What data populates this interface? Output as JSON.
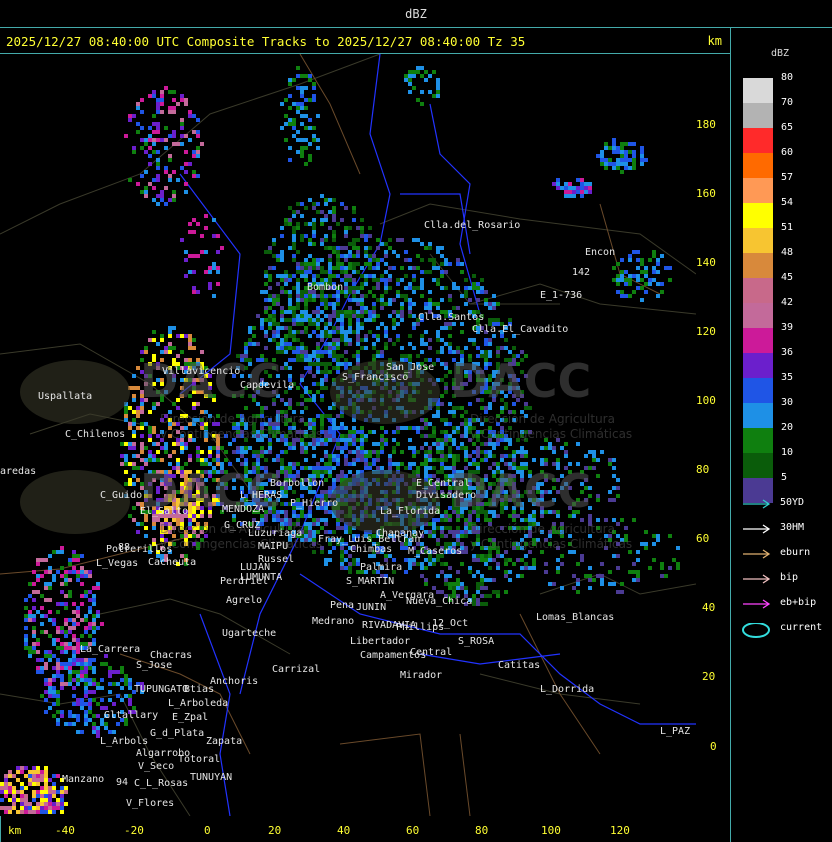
{
  "header": {
    "unit": "dBZ"
  },
  "title": {
    "text": "2025/12/27 08:40:00 UTC Composite Tracks to 2025/12/27 08:40:00 Tz 35",
    "km_label": "km"
  },
  "axes": {
    "y_ticks": [
      "180",
      "160",
      "140",
      "120",
      "100",
      "80",
      "60",
      "40",
      "20",
      "0"
    ],
    "x_ticks": [
      "-40",
      "-20",
      "0",
      "20",
      "40",
      "60",
      "80",
      "100",
      "120"
    ],
    "x_unit": "km"
  },
  "legend": {
    "title": "dBZ",
    "scale": [
      {
        "value": "80",
        "color": "#d9d9d9"
      },
      {
        "value": "70",
        "color": "#b3b3b3"
      },
      {
        "value": "65",
        "color": "#ff2a2a"
      },
      {
        "value": "60",
        "color": "#ff6a00"
      },
      {
        "value": "57",
        "color": "#ff9955"
      },
      {
        "value": "54",
        "color": "#ffff00"
      },
      {
        "value": "51",
        "color": "#f7c531"
      },
      {
        "value": "48",
        "color": "#d8893b"
      },
      {
        "value": "45",
        "color": "#c8698a"
      },
      {
        "value": "42",
        "color": "#c36a9a"
      },
      {
        "value": "39",
        "color": "#cc1a99"
      },
      {
        "value": "36",
        "color": "#6b1fcc"
      },
      {
        "value": "35",
        "color": "#1f55e6"
      },
      {
        "value": "30",
        "color": "#1e90e6"
      },
      {
        "value": "20",
        "color": "#0f7f0f"
      },
      {
        "value": "10",
        "color": "#0a5c0a"
      },
      {
        "value": "5",
        "color": "#4b3a93"
      }
    ],
    "tracks": [
      {
        "label": "50YD",
        "color": "#33cccc"
      },
      {
        "label": "30HM",
        "color": "#ffffff"
      },
      {
        "label": "eburn",
        "color": "#e0b070"
      },
      {
        "label": "bip",
        "color": "#f0c0c0"
      },
      {
        "label": "eb+bip",
        "color": "#ff44ff"
      },
      {
        "label": "current",
        "color": "#33dddd"
      }
    ]
  },
  "watermark": {
    "name": "DACC",
    "line1": "Dirección de Agricultura",
    "line2": "y Contingencias Climáticas"
  },
  "places": [
    {
      "name": "Clla.del_Rosario"
    },
    {
      "name": "Encon"
    },
    {
      "name": "E_1-736"
    },
    {
      "name": "142"
    },
    {
      "name": "Bombon"
    },
    {
      "name": "Clla.Santos"
    },
    {
      "name": "Clla.El_Cavadito"
    },
    {
      "name": "Villavicencio"
    },
    {
      "name": "Capdevila"
    },
    {
      "name": "S_Francisco"
    },
    {
      "name": "San_Jose"
    },
    {
      "name": "Uspallata"
    },
    {
      "name": "C_Chilenos"
    },
    {
      "name": "aredas"
    },
    {
      "name": "C_Guido"
    },
    {
      "name": "El_Salto"
    },
    {
      "name": "L_HERAS"
    },
    {
      "name": "MENDOZA"
    },
    {
      "name": "G_CRUZ"
    },
    {
      "name": "Luzuriaga"
    },
    {
      "name": "Borbollon"
    },
    {
      "name": "P_Hierro"
    },
    {
      "name": "Fray_Luis_Beltran"
    },
    {
      "name": "Chimbas"
    },
    {
      "name": "Chapanay"
    },
    {
      "name": "M_Caseros"
    },
    {
      "name": "Divisadero"
    },
    {
      "name": "E_Central"
    },
    {
      "name": "La_Florida"
    },
    {
      "name": "Potrerillos"
    },
    {
      "name": "L_Vegas"
    },
    {
      "name": "Cacheuta"
    },
    {
      "name": "MAIPU"
    },
    {
      "name": "Russel"
    },
    {
      "name": "LUJAN"
    },
    {
      "name": "LUMUNTA"
    },
    {
      "name": "Perdriel"
    },
    {
      "name": "Agrelo"
    },
    {
      "name": "S_MARTIN"
    },
    {
      "name": "Palmira"
    },
    {
      "name": "A_Vergara"
    },
    {
      "name": "Nueva_Chica"
    },
    {
      "name": "JUNIN"
    },
    {
      "name": "Pena"
    },
    {
      "name": "Ugarteche"
    },
    {
      "name": "Medrano"
    },
    {
      "name": "RIVADAVIA"
    },
    {
      "name": "Phillips"
    },
    {
      "name": "12_Oct"
    },
    {
      "name": "Lomas_Blancas"
    },
    {
      "name": "S_ROSA"
    },
    {
      "name": "Libertador"
    },
    {
      "name": "Campamentos"
    },
    {
      "name": "Central"
    },
    {
      "name": "Catitas"
    },
    {
      "name": "Carrizal"
    },
    {
      "name": "Mirador"
    },
    {
      "name": "La_Carrera"
    },
    {
      "name": "S_Jose"
    },
    {
      "name": "Chacras"
    },
    {
      "name": "Anchoris"
    },
    {
      "name": "TUPUNGATO"
    },
    {
      "name": "Btias"
    },
    {
      "name": "L_Arboleda"
    },
    {
      "name": "Gltallary"
    },
    {
      "name": "E_Zpal"
    },
    {
      "name": "G_d_Plata"
    },
    {
      "name": "L_Arbols"
    },
    {
      "name": "Zapata"
    },
    {
      "name": "Algarrobo"
    },
    {
      "name": "V_Seco"
    },
    {
      "name": "Totoral"
    },
    {
      "name": "TUNUYAN"
    },
    {
      "name": "Manzano"
    },
    {
      "name": "C_L_Rosas"
    },
    {
      "name": "V_Flores"
    },
    {
      "name": "L_Dorrida"
    },
    {
      "name": "L_PAZ"
    },
    {
      "name": "88"
    },
    {
      "name": "94"
    }
  ]
}
